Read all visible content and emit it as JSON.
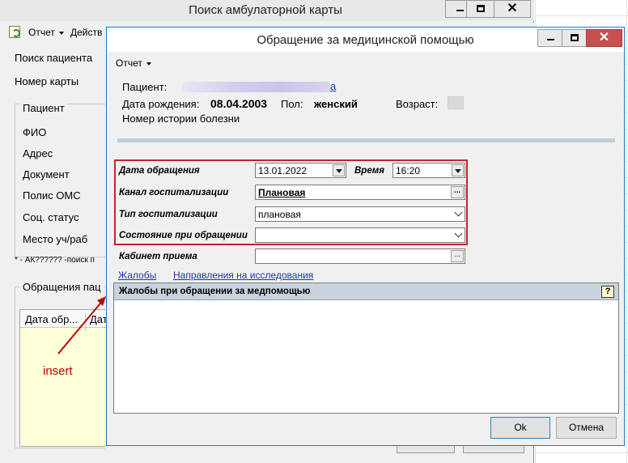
{
  "background_window": {
    "title": "Поиск амбулаторной карты",
    "menu": {
      "report": "Отчет",
      "actions": "Действ"
    },
    "search_patient": "Поиск пациента",
    "card_number": "Номер карты",
    "patient_group": "Пациент",
    "fields": [
      "ФИО",
      "Адрес",
      "Документ",
      "Полис ОМС",
      "Соц. статус",
      "Место уч/раб"
    ],
    "note": "* - АК?????? -поиск п",
    "visits_group": "Обращения пац",
    "grid_col1": "Дата обр...",
    "grid_col2": "Дат"
  },
  "annotation": {
    "label": "insert",
    "color": "#c00000"
  },
  "dialog": {
    "title": "Обращение за медицинской помощью",
    "menu": {
      "report": "Отчет"
    },
    "patient": {
      "label": "Пациент:",
      "name_tail": "a",
      "dob_label": "Дата рождения:",
      "dob": "08.04.2003",
      "sex_label": "Пол:",
      "sex": "женский",
      "age_label": "Возраст:",
      "history_label": "Номер истории болезни"
    },
    "form": {
      "date_label": "Дата обращения",
      "date_value": "13.01.2022",
      "time_label": "Время",
      "time_value": "16:20",
      "channel_label": "Канал госпитализации",
      "channel_value": "Плановая",
      "type_label": "Тип госпитализации",
      "type_value": "плановая",
      "state_label": "Состояние при обращении",
      "state_value": "",
      "room_label": "Кабинет приема",
      "room_value": ""
    },
    "tabs": {
      "complaints": "Жалобы",
      "referrals": "Направления на исследования"
    },
    "panel_title": "Жалобы при обращении за медпомощью",
    "buttons": {
      "ok": "Ok",
      "cancel": "Отмена"
    },
    "accent": "#c5232b"
  }
}
